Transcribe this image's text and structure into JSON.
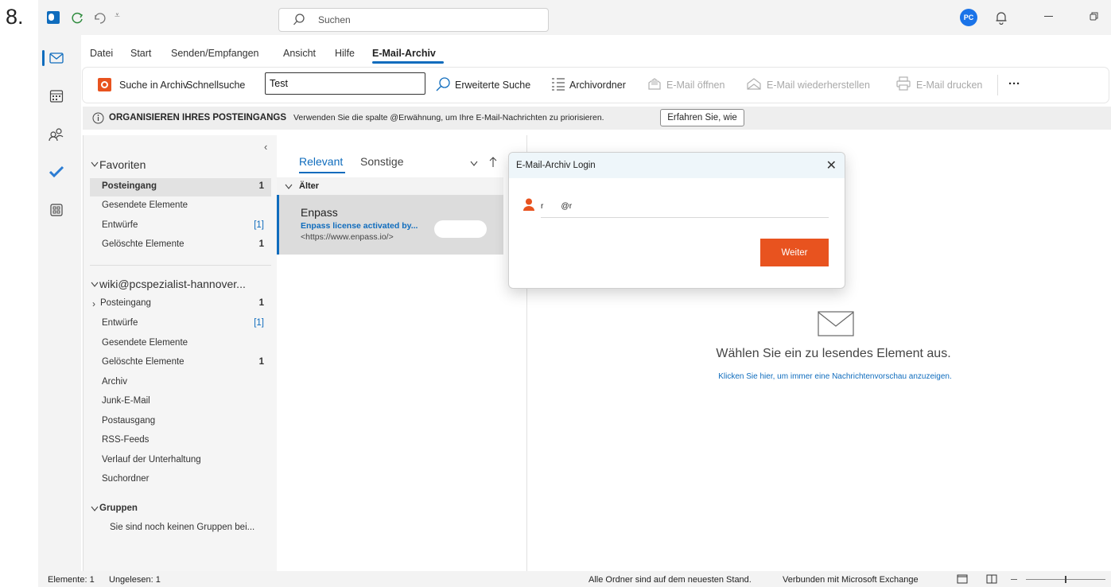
{
  "step_label": "8.",
  "search": {
    "placeholder": "Suchen"
  },
  "menu": {
    "items": [
      "Datei",
      "Start",
      "Senden/Empfangen",
      "Ansicht",
      "Hilfe",
      "E-Mail-Archiv"
    ],
    "active": "E-Mail-Archiv"
  },
  "ribbon": {
    "search_archive": "Suche in Archiv",
    "quick_search_label": "Schnellsuche",
    "quick_search_value": "Test",
    "advanced_search": "Erweiterte Suche",
    "archive_folder": "Archivordner",
    "open_email": "E-Mail öffnen",
    "restore_email": "E-Mail wiederherstellen",
    "print_email": "E-Mail drucken",
    "more": "···"
  },
  "infobar": {
    "heading": "ORGANISIEREN IHRES POSTEINGANGS",
    "message": "Verwenden Sie die spalte @Erwähnung, um Ihre E-Mail-Nachrichten zu priorisieren.",
    "button": "Erfahren Sie, wie"
  },
  "folders": {
    "collapse": "‹",
    "favorites_header": "Favoriten",
    "favorites": [
      {
        "name": "Posteingang",
        "count": "1",
        "bold": true
      },
      {
        "name": "Gesendete Elemente",
        "count": ""
      },
      {
        "name": "Entwürfe",
        "count": "[1]"
      },
      {
        "name": "Gelöschte Elemente",
        "count": "1",
        "bold": true
      }
    ],
    "account_header": "wiki@pcspezialist-hannover...",
    "account": [
      {
        "name": "Posteingang",
        "count": "1",
        "bold": true
      },
      {
        "name": "Entwürfe",
        "count": "[1]"
      },
      {
        "name": "Gesendete Elemente",
        "count": ""
      },
      {
        "name": "Gelöschte Elemente",
        "count": "1",
        "bold": true
      },
      {
        "name": "Archiv",
        "count": ""
      },
      {
        "name": "Junk-E-Mail",
        "count": ""
      },
      {
        "name": "Postausgang",
        "count": ""
      },
      {
        "name": "RSS-Feeds",
        "count": ""
      },
      {
        "name": "Verlauf der Unterhaltung",
        "count": ""
      },
      {
        "name": "Suchordner",
        "count": ""
      }
    ],
    "groups_header": "Gruppen",
    "groups_text": "Sie sind noch keinen Gruppen bei..."
  },
  "message_list": {
    "tab_relevant": "Relevant",
    "tab_other": "Sonstige",
    "group": "Älter",
    "messages": [
      {
        "sender": "Enpass",
        "subject": "Enpass license activated by...",
        "preview": "<https://www.enpass.io/>"
      }
    ]
  },
  "reading": {
    "title": "Wählen Sie ein zu lesendes Element aus.",
    "link": "Klicken Sie hier, um immer eine Nachrichtenvorschau anzuzeigen."
  },
  "dialog": {
    "title": "E-Mail-Archiv Login",
    "user_value": "r        @r",
    "button": "Weiter"
  },
  "status": {
    "items": "Elemente: 1",
    "unread": "Ungelesen: 1",
    "sync": "Alle Ordner sind auf dem neuesten Stand.",
    "connection": "Verbunden mit Microsoft Exchange"
  },
  "colors": {
    "accent": "#0f6cbd",
    "orange": "#e8531f"
  }
}
